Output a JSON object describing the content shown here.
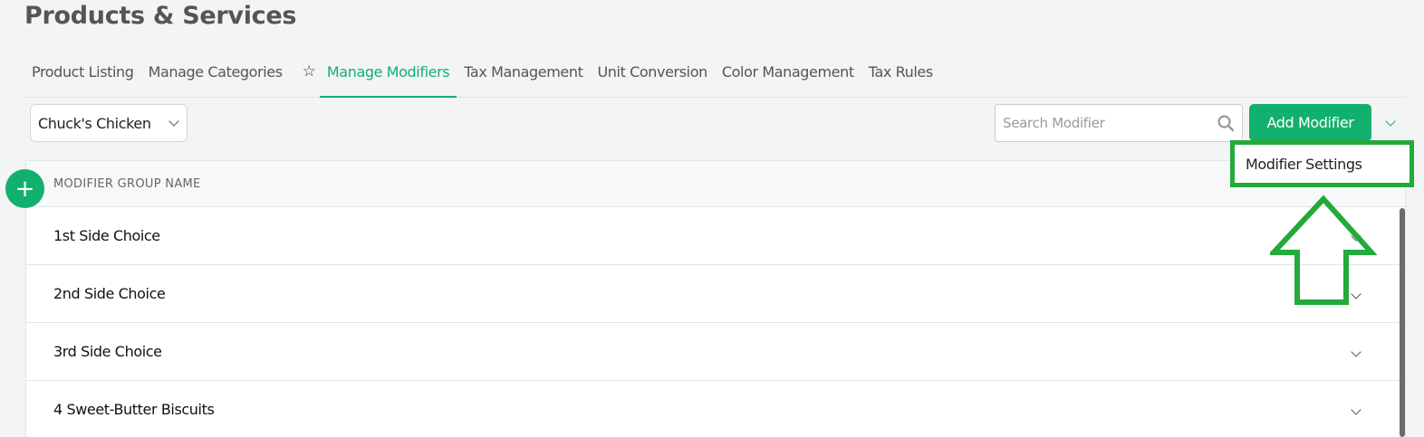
{
  "page": {
    "title": "Products & Services"
  },
  "tabs": [
    {
      "label": "Product Listing"
    },
    {
      "label": "Manage Categories"
    },
    {
      "label": "Manage Modifiers",
      "active": true
    },
    {
      "label": "Tax Management"
    },
    {
      "label": "Unit Conversion"
    },
    {
      "label": "Color Management"
    },
    {
      "label": "Tax Rules"
    }
  ],
  "toolbar": {
    "store_select": "Chuck's Chicken",
    "search_placeholder": "Search Modifier",
    "add_label": "Add Modifier",
    "menu_item": "Modifier Settings"
  },
  "table": {
    "header": "MODIFIER GROUP NAME",
    "rows": [
      "1st Side Choice",
      "2nd Side Choice",
      "3rd Side Choice",
      "4 Sweet-Butter Biscuits"
    ]
  },
  "colors": {
    "accent": "#12b06e",
    "annotation": "#22aa3a"
  },
  "icons": {
    "star": "star-icon",
    "search": "search-icon",
    "chevron": "chevron-down-icon",
    "add": "plus-icon"
  }
}
